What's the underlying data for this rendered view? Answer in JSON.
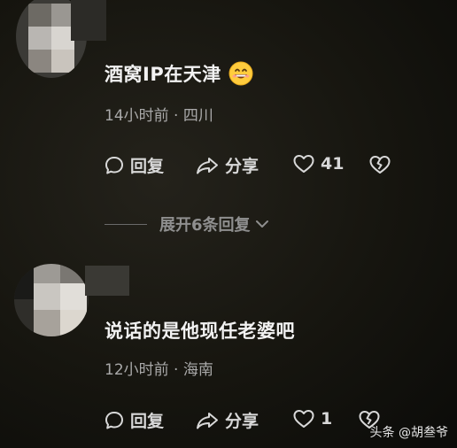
{
  "comments": [
    {
      "text": "酒窝IP在天津",
      "time": "14小时前",
      "separator": "·",
      "location": "四川",
      "reply_label": "回复",
      "share_label": "分享",
      "like_count": "41",
      "expand_label": "展开6条回复"
    },
    {
      "text": "说话的是他现任老婆吧",
      "time": "12小时前",
      "separator": "·",
      "location": "海南",
      "reply_label": "回复",
      "share_label": "分享",
      "like_count": "1"
    }
  ],
  "watermark": "头条 @胡叁爷",
  "icons": {
    "reply": "comment-bubble-icon",
    "share": "share-arrow-icon",
    "like": "heart-outline-icon",
    "dislike": "broken-heart-icon",
    "emoji": "grinning-emoji-icon",
    "expand": "chevron-down-icon"
  },
  "colors": {
    "background": "#16150f",
    "text_primary": "#f2f2f2",
    "text_secondary": "#a9a9a9",
    "text_muted": "#8f8f8f"
  }
}
